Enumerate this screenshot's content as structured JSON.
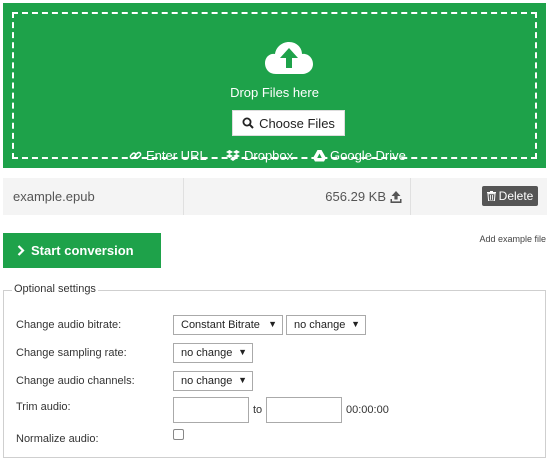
{
  "upload": {
    "drop_text": "Drop Files here",
    "choose_label": "Choose Files",
    "sources": [
      {
        "label": "Enter URL",
        "icon": "link-icon"
      },
      {
        "label": "Dropbox",
        "icon": "dropbox-icon"
      },
      {
        "label": "Google Drive",
        "icon": "google-drive-icon"
      }
    ]
  },
  "file": {
    "name": "example.epub",
    "size": "656.29 KB",
    "delete_label": "Delete"
  },
  "actions": {
    "start_label": "Start conversion",
    "add_example_label": "Add example file"
  },
  "settings": {
    "legend": "Optional settings",
    "bitrate_label": "Change audio bitrate:",
    "bitrate_mode": "Constant Bitrate",
    "bitrate_value": "no change",
    "sampling_label": "Change sampling rate:",
    "sampling_value": "no change",
    "channels_label": "Change audio channels:",
    "channels_value": "no change",
    "trim_label": "Trim audio:",
    "trim_to": "to",
    "trim_time": "00:00:00",
    "normalize_label": "Normalize audio:"
  },
  "colors": {
    "accent": "#1ea24a",
    "delete_bg": "#555555"
  }
}
